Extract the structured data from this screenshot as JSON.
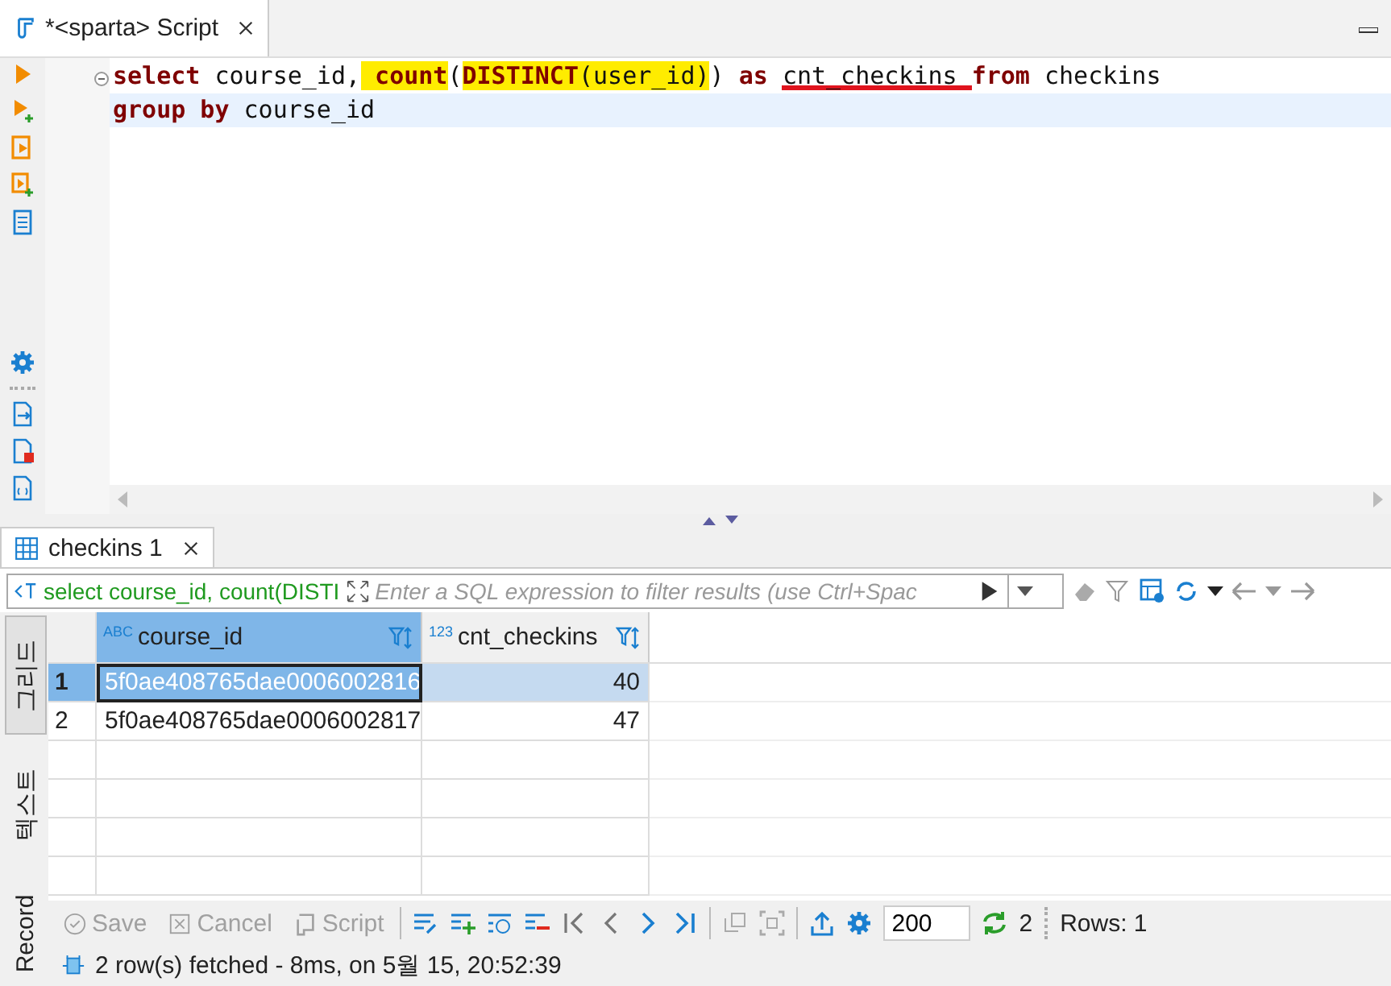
{
  "editor_tab": {
    "title": "*<sparta> Script",
    "selected": true
  },
  "code": {
    "lines": [
      {
        "current": false,
        "tokens": [
          {
            "text": "select",
            "kind": "keyword",
            "highlighted": false,
            "underlined": false
          },
          {
            "text": " course_id,",
            "kind": "plain",
            "highlighted": false,
            "underlined": false
          },
          {
            "text": " count",
            "kind": "keyword",
            "highlighted": true,
            "underlined": false
          },
          {
            "text": "(",
            "kind": "plain",
            "highlighted": false,
            "underlined": false
          },
          {
            "text": "DISTINCT",
            "kind": "keyword",
            "highlighted": true,
            "underlined": false
          },
          {
            "text": "(user_id)",
            "kind": "plain",
            "highlighted": true,
            "underlined": false
          },
          {
            "text": ") ",
            "kind": "plain",
            "highlighted": false,
            "underlined": false
          },
          {
            "text": "as ",
            "kind": "keyword",
            "highlighted": false,
            "underlined": false
          },
          {
            "text": "cnt_checkins ",
            "kind": "plain",
            "highlighted": false,
            "underlined": true
          },
          {
            "text": "from",
            "kind": "keyword",
            "highlighted": false,
            "underlined": false
          },
          {
            "text": " checkins",
            "kind": "plain",
            "highlighted": false,
            "underlined": false
          }
        ]
      },
      {
        "current": true,
        "tokens": [
          {
            "text": "group by",
            "kind": "keyword",
            "highlighted": false,
            "underlined": false
          },
          {
            "text": " course_id",
            "kind": "plain",
            "highlighted": false,
            "underlined": false
          }
        ]
      }
    ]
  },
  "results_tab": {
    "title": "checkins 1",
    "selected": true
  },
  "filter": {
    "query": "select course_id, count(DISTI",
    "placeholder": "Enter a SQL expression to filter results (use Ctrl+Spac"
  },
  "view_tabs": [
    {
      "label": "그리드",
      "selected": true
    },
    {
      "label": "텍스트",
      "selected": false
    },
    {
      "label": "Record",
      "selected": false
    }
  ],
  "grid": {
    "columns": [
      {
        "type_label": "ABC",
        "name": "course_id",
        "kind": "text",
        "selected": true
      },
      {
        "type_label": "123",
        "name": "cnt_checkins",
        "kind": "number",
        "selected": false
      }
    ],
    "rows": [
      {
        "number": "1",
        "selected": true,
        "cells": [
          {
            "text": "5f0ae408765dae0006002816",
            "focused": true
          },
          {
            "text": "40",
            "focused": false
          }
        ]
      },
      {
        "number": "2",
        "selected": false,
        "cells": [
          {
            "text": "5f0ae408765dae0006002817",
            "focused": false
          },
          {
            "text": "47",
            "focused": false
          }
        ]
      }
    ]
  },
  "toolbar": {
    "actions": [
      {
        "label": "Save",
        "kind": "save",
        "disabled": true
      },
      {
        "label": "Cancel",
        "kind": "cancel",
        "disabled": true
      },
      {
        "label": "Script",
        "kind": "script",
        "disabled": true
      }
    ],
    "fetch_size": "200",
    "refresh_count": "2",
    "rows_label": "Rows: 1"
  },
  "status": "2 row(s) fetched - 8ms, on 5월 15, 20:52:39"
}
